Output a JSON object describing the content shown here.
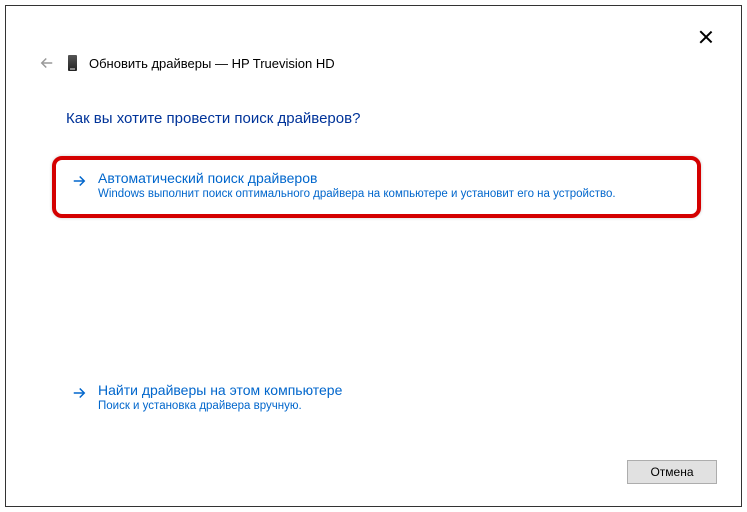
{
  "header": {
    "title": "Обновить драйверы — HP Truevision HD"
  },
  "question": "Как вы хотите провести поиск драйверов?",
  "options": {
    "auto": {
      "title": "Автоматический поиск драйверов",
      "desc": "Windows выполнит поиск оптимального драйвера на компьютере и установит его на устройство."
    },
    "manual": {
      "title": "Найти драйверы на этом компьютере",
      "desc": "Поиск и установка драйвера вручную."
    }
  },
  "buttons": {
    "cancel": "Отмена"
  }
}
